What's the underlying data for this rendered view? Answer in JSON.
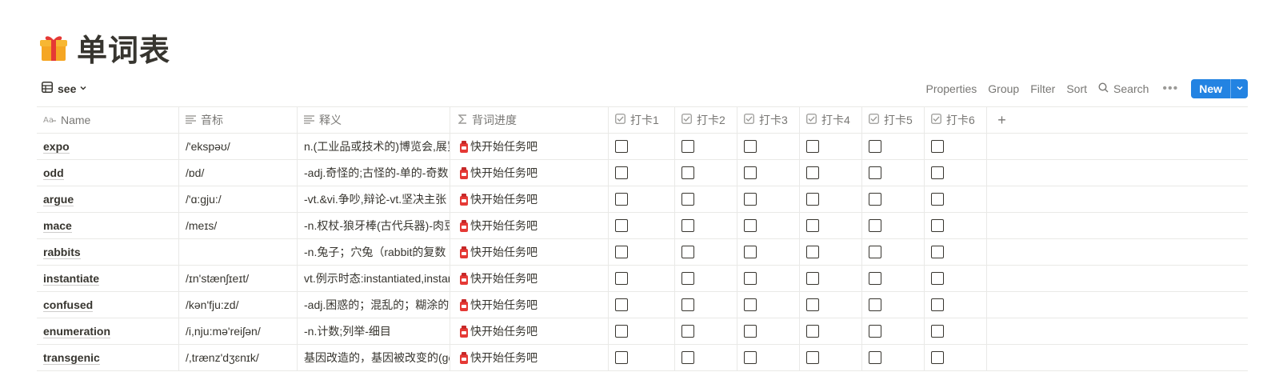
{
  "page": {
    "title": "单词表",
    "title_icon": "gift-icon"
  },
  "view": {
    "tab_label": "see",
    "tab_icon": "table-icon"
  },
  "toolbar": {
    "properties": "Properties",
    "group": "Group",
    "filter": "Filter",
    "sort": "Sort",
    "search": "Search",
    "more": "•••",
    "new": "New",
    "accent": "#2383e2"
  },
  "columns": {
    "name": "Name",
    "phonetic": "音标",
    "definition": "释义",
    "progress": "背词进度",
    "check1": "打卡1",
    "check2": "打卡2",
    "check3": "打卡3",
    "check4": "打卡4",
    "check5": "打卡5",
    "check6": "打卡6"
  },
  "rows": [
    {
      "name": "expo",
      "phonetic": "/'ekspəʊ/",
      "definition": "n.(工业品或技术的)博览会,展览",
      "progress": "快开始任务吧"
    },
    {
      "name": "odd",
      "phonetic": "/ɒd/",
      "definition": "-adj.奇怪的;古怪的-单的-奇数",
      "progress": "快开始任务吧"
    },
    {
      "name": "argue",
      "phonetic": "/'ɑ:gju:/",
      "definition": "-vt.&vi.争吵,辩论-vt.坚决主张",
      "progress": "快开始任务吧"
    },
    {
      "name": "mace",
      "phonetic": "/meɪs/",
      "definition": "-n.权杖-狼牙棒(古代兵器)-肉豆",
      "progress": "快开始任务吧"
    },
    {
      "name": "rabbits",
      "phonetic": "",
      "definition": "-n.兔子；穴兔（rabbit的复数",
      "progress": "快开始任务吧"
    },
    {
      "name": "instantiate",
      "phonetic": "/ɪn'stænʃɪeɪt/",
      "definition": "vt.例示时态:instantiated,instant",
      "progress": "快开始任务吧"
    },
    {
      "name": "confused",
      "phonetic": "/kən'fju:zd/",
      "definition": "-adj.困惑的；混乱的；糊涂的",
      "progress": "快开始任务吧"
    },
    {
      "name": "enumeration",
      "phonetic": "/i,nju:mə'reiʃən/",
      "definition": "-n.计数;列举-细目",
      "progress": "快开始任务吧"
    },
    {
      "name": "transgenic",
      "phonetic": "/,trænz'dʒɛnɪk/",
      "definition": "基因改造的，基因被改变的(ge",
      "progress": "快开始任务吧"
    }
  ]
}
